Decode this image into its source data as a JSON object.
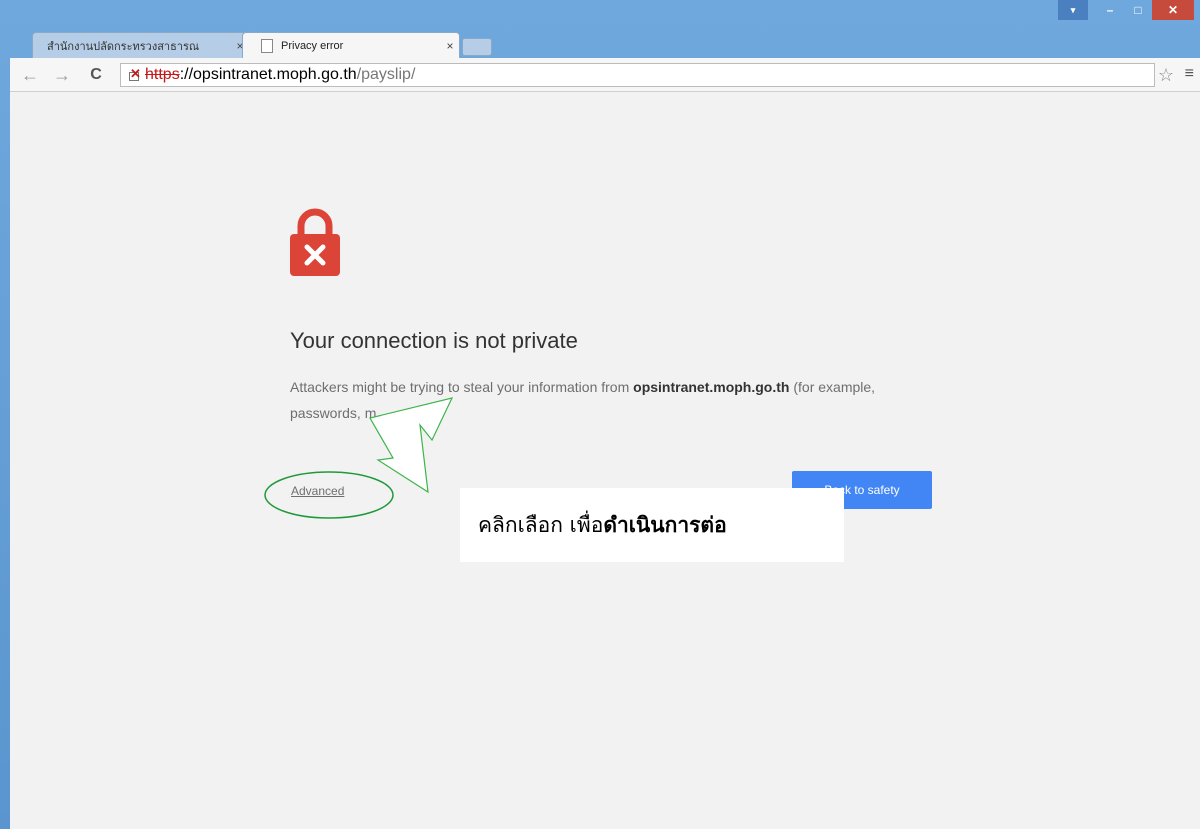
{
  "window": {
    "controls": {
      "menu": "▾",
      "minimize": "–",
      "maximize": "□",
      "close": "✕"
    }
  },
  "tabs": [
    {
      "title": "สำนักงานปลัดกระทรวงสาธารณ",
      "close": "×",
      "active": false
    },
    {
      "title": "Privacy error",
      "close": "×",
      "active": true
    }
  ],
  "toolbar": {
    "back": "←",
    "forward": "→",
    "reload": "C",
    "url_scheme": "https",
    "url_host": "://opsintranet.moph.go.th",
    "url_path": "/payslip/",
    "star": "☆",
    "menu": "≡"
  },
  "page": {
    "headline": "Your connection is not private",
    "para_prefix": "Attackers might be trying to steal your information from ",
    "para_host": "opsintranet.moph.go.th",
    "para_suffix": " (for example, passwords, m",
    "advanced_link": "Advanced",
    "back_button": "Back to safety"
  },
  "annotation": {
    "callout_prefix": "คลิกเลือก เพื่อ",
    "callout_bold": "ดำเนินการต่อ",
    "ellipse_color": "#1f9a3a",
    "arrow_color": "#3db54a"
  },
  "colors": {
    "padlock": "#db4437",
    "button": "#4285f4",
    "titlebar": "#6fa8dc"
  }
}
